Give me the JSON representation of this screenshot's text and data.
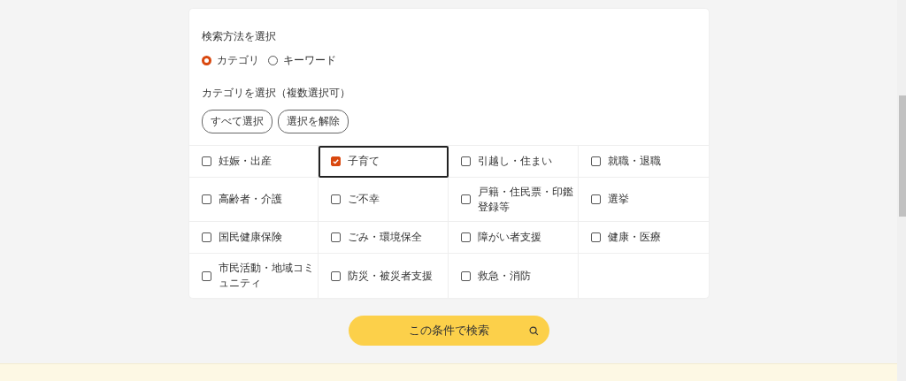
{
  "search_method": {
    "label": "検索方法を選択",
    "options": [
      {
        "label": "カテゴリ",
        "selected": true
      },
      {
        "label": "キーワード",
        "selected": false
      }
    ]
  },
  "category": {
    "label": "カテゴリを選択（複数選択可）",
    "buttons": [
      "すべて選択",
      "選択を解除"
    ],
    "items": [
      {
        "label": "妊娠・出産",
        "checked": false,
        "focused": false
      },
      {
        "label": "子育て",
        "checked": true,
        "focused": true
      },
      {
        "label": "引越し・住まい",
        "checked": false,
        "focused": false
      },
      {
        "label": "就職・退職",
        "checked": false,
        "focused": false
      },
      {
        "label": "高齢者・介護",
        "checked": false,
        "focused": false
      },
      {
        "label": "ご不幸",
        "checked": false,
        "focused": false
      },
      {
        "label": "戸籍・住民票・印鑑登録等",
        "checked": false,
        "focused": false
      },
      {
        "label": "選挙",
        "checked": false,
        "focused": false
      },
      {
        "label": "国民健康保険",
        "checked": false,
        "focused": false
      },
      {
        "label": "ごみ・環境保全",
        "checked": false,
        "focused": false
      },
      {
        "label": "障がい者支援",
        "checked": false,
        "focused": false
      },
      {
        "label": "健康・医療",
        "checked": false,
        "focused": false
      },
      {
        "label": "市民活動・地域コミュニティ",
        "checked": false,
        "focused": false
      },
      {
        "label": "防災・被災者支援",
        "checked": false,
        "focused": false
      },
      {
        "label": "救急・消防",
        "checked": false,
        "focused": false
      }
    ]
  },
  "submit": {
    "label": "この条件で検索"
  }
}
